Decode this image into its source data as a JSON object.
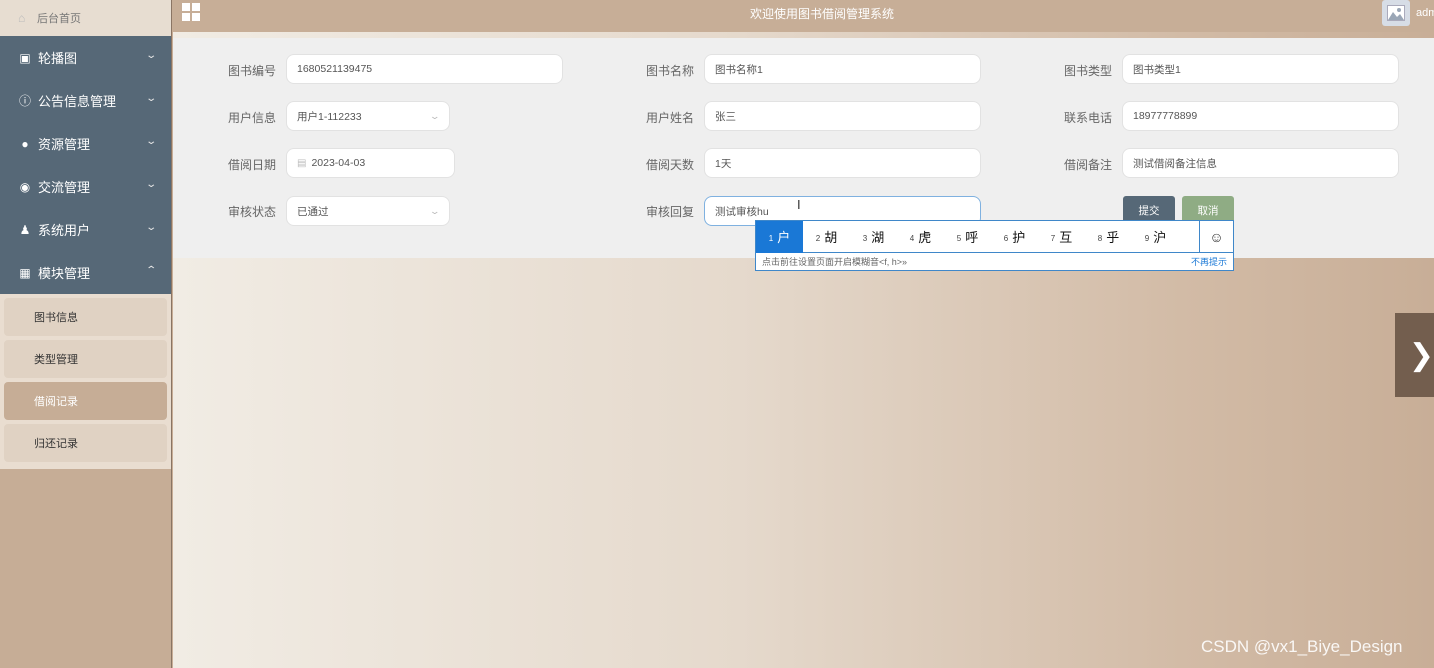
{
  "sidebar": {
    "home_label": "后台首页",
    "menu": [
      {
        "label": "轮播图",
        "icon": "picture-icon",
        "glyph": "▣",
        "expanded": false
      },
      {
        "label": "公告信息管理",
        "icon": "info-circle-icon",
        "glyph": "ⓘ",
        "expanded": false
      },
      {
        "label": "资源管理",
        "icon": "lightbulb-icon",
        "glyph": "●",
        "expanded": false
      },
      {
        "label": "交流管理",
        "icon": "chat-icon",
        "glyph": "◉",
        "expanded": false
      },
      {
        "label": "系统用户",
        "icon": "user-icon",
        "glyph": "♟",
        "expanded": false
      },
      {
        "label": "模块管理",
        "icon": "grid-icon",
        "glyph": "▦",
        "expanded": true
      }
    ],
    "submenu": [
      {
        "label": "图书信息",
        "active": false
      },
      {
        "label": "类型管理",
        "active": false
      },
      {
        "label": "借阅记录",
        "active": true
      },
      {
        "label": "归还记录",
        "active": false
      }
    ]
  },
  "header": {
    "title": "欢迎使用图书借阅管理系统",
    "username": "adm"
  },
  "form": {
    "book_no": {
      "label": "图书编号",
      "value": "1680521139475"
    },
    "book_name": {
      "label": "图书名称",
      "value": "图书名称1"
    },
    "book_type": {
      "label": "图书类型",
      "value": "图书类型1"
    },
    "user_info": {
      "label": "用户信息",
      "value": "用户1-112233"
    },
    "user_name": {
      "label": "用户姓名",
      "value": "张三"
    },
    "phone": {
      "label": "联系电话",
      "value": "18977778899"
    },
    "borrow_date": {
      "label": "借阅日期",
      "value": "2023-04-03"
    },
    "borrow_days": {
      "label": "借阅天数",
      "value": "1天"
    },
    "borrow_note": {
      "label": "借阅备注",
      "value": "测试借阅备注信息"
    },
    "audit_status": {
      "label": "审核状态",
      "value": "已通过"
    },
    "audit_reply": {
      "label": "审核回复",
      "value": "测试审核hu"
    },
    "submit_label": "提交",
    "cancel_label": "取消"
  },
  "ime": {
    "candidates": [
      {
        "n": "1",
        "ch": "户"
      },
      {
        "n": "2",
        "ch": "胡"
      },
      {
        "n": "3",
        "ch": "湖"
      },
      {
        "n": "4",
        "ch": "虎"
      },
      {
        "n": "5",
        "ch": "呼"
      },
      {
        "n": "6",
        "ch": "护"
      },
      {
        "n": "7",
        "ch": "互"
      },
      {
        "n": "8",
        "ch": "乎"
      },
      {
        "n": "9",
        "ch": "沪"
      }
    ],
    "emoji_glyph": "☺",
    "hint": "点击前往设置页面开启模糊音<f, h>»",
    "dismiss": "不再提示"
  },
  "watermark": "CSDN @vx1_Biye_Design",
  "colors": {
    "sidebar_menu": "#566877",
    "accent": "#c6ad96",
    "submit": "#566877",
    "cancel": "#8fac84",
    "ime_selected": "#1a78d6"
  }
}
